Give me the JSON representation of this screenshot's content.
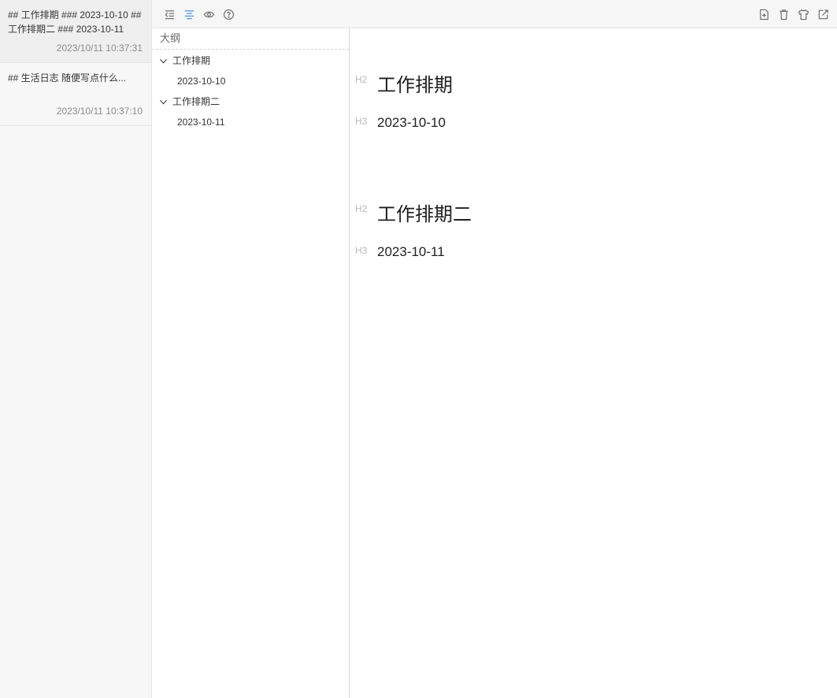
{
  "notes": [
    {
      "preview": "## 工作排期 ### 2023-10-10 ## 工作排期二 ### 2023-10-11",
      "time": "2023/10/11 10:37:31"
    },
    {
      "preview": "## 生活日志 随便写点什么...",
      "time": "2023/10/11 10:37:10"
    }
  ],
  "toolbar": {
    "left_icons": [
      "outdent-icon",
      "align-center-icon",
      "eye-icon",
      "help-circle-icon"
    ],
    "right_icons": [
      "new-file-icon",
      "trash-icon",
      "shirt-icon",
      "export-icon"
    ],
    "active_color": "#4a90e2"
  },
  "outline": {
    "title": "大纲",
    "items": [
      {
        "level": "h2",
        "text": "工作排期",
        "expanded": true
      },
      {
        "level": "h3",
        "text": "2023-10-10"
      },
      {
        "level": "h2",
        "text": "工作排期二",
        "expanded": true
      },
      {
        "level": "h3",
        "text": "2023-10-11"
      }
    ]
  },
  "editor": {
    "blocks": [
      {
        "tag": "H2",
        "text": "工作排期"
      },
      {
        "tag": "H3",
        "text": "2023-10-10"
      },
      {
        "tag": "H2",
        "text": "工作排期二"
      },
      {
        "tag": "H3",
        "text": "2023-10-11"
      }
    ]
  }
}
